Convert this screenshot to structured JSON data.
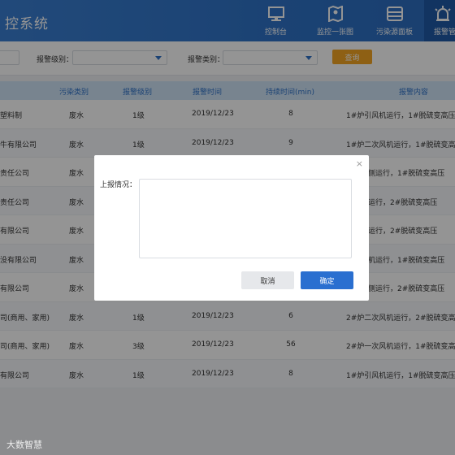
{
  "header": {
    "app_title": "控系统",
    "nav": [
      {
        "label": "控制台",
        "icon": "monitor-icon"
      },
      {
        "label": "监控一张图",
        "icon": "map-icon"
      },
      {
        "label": "污染源面板",
        "icon": "panel-icon"
      },
      {
        "label": "报警管",
        "icon": "alarm-icon",
        "active": true
      }
    ]
  },
  "filters": {
    "level_label": "报警级别：",
    "type_label": "报警类别：",
    "query_label": "查询"
  },
  "table": {
    "headers": [
      "污染类别",
      "报警级别",
      "报警时间",
      "持续时间(min)",
      "报警内容"
    ],
    "rows": [
      {
        "company": "塑料制",
        "pollution": "废水",
        "level": "1级",
        "time": "2019/12/23",
        "duration": "8",
        "content": "1#炉引风机运行，1#脱硫变高压"
      },
      {
        "company": "牛有限公司",
        "pollution": "废水",
        "level": "1级",
        "time": "2019/12/23",
        "duration": "9",
        "content": "1#炉二次风机运行，1#脱硫变高压"
      },
      {
        "company": "责任公司",
        "pollution": "废水",
        "level": "",
        "time": "",
        "duration": "",
        "content": "变高压侧运行，1#脱硫变高压"
      },
      {
        "company": "责任公司",
        "pollution": "废水",
        "level": "",
        "time": "",
        "duration": "",
        "content": "引风机运行，2#脱硫变高压"
      },
      {
        "company": "有限公司",
        "pollution": "废水",
        "level": "",
        "time": "",
        "duration": "",
        "content": "引风机运行，2#脱硫变高压"
      },
      {
        "company": "没有限公司",
        "pollution": "废水",
        "level": "",
        "time": "",
        "duration": "",
        "content": "一次风机运行，1#脱硫变高压"
      },
      {
        "company": "有限公司",
        "pollution": "废水",
        "level": "",
        "time": "",
        "duration": "",
        "content": "变高压侧运行，2#脱硫变高压"
      },
      {
        "company": "司(商用、家用)",
        "pollution": "废水",
        "level": "1级",
        "time": "2019/12/23",
        "duration": "6",
        "content": "2#炉二次风机运行，2#脱硫变高压"
      },
      {
        "company": "司(商用、家用)",
        "pollution": "废水",
        "level": "3级",
        "time": "2019/12/23",
        "duration": "56",
        "content": "2#炉一次风机运行，1#脱硫变高压"
      },
      {
        "company": "有限公司",
        "pollution": "废水",
        "level": "1级",
        "time": "2019/12/23",
        "duration": "8",
        "content": "1#炉引风机运行，1#脱硫变高压"
      }
    ]
  },
  "modal": {
    "label": "上报情况：",
    "close": "×",
    "cancel_label": "取消",
    "ok_label": "确定"
  },
  "watermark": "大数智慧"
}
